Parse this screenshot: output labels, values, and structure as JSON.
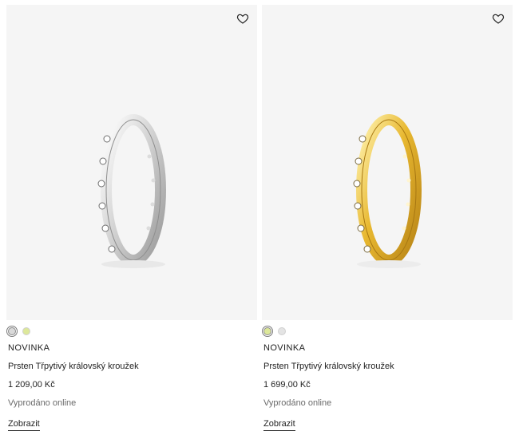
{
  "products": [
    {
      "badge": "NOVINKA",
      "name": "Prsten Třpytivý královský kroužek",
      "price": "1 209,00 Kč",
      "status": "Vyprodáno online",
      "cta": "Zobrazit",
      "metal": "silver",
      "swatches": [
        {
          "color": "#d9d9d9",
          "selected": true
        },
        {
          "color": "#dde89a",
          "selected": false
        }
      ]
    },
    {
      "badge": "NOVINKA",
      "name": "Prsten Třpytivý královský kroužek",
      "price": "1 699,00 Kč",
      "status": "Vyprodáno online",
      "cta": "Zobrazit",
      "metal": "gold",
      "swatches": [
        {
          "color": "#dde89a",
          "selected": true
        },
        {
          "color": "#e4e4e4",
          "selected": false
        }
      ]
    }
  ],
  "icons": {
    "wishlist": "heart-outline-icon"
  }
}
